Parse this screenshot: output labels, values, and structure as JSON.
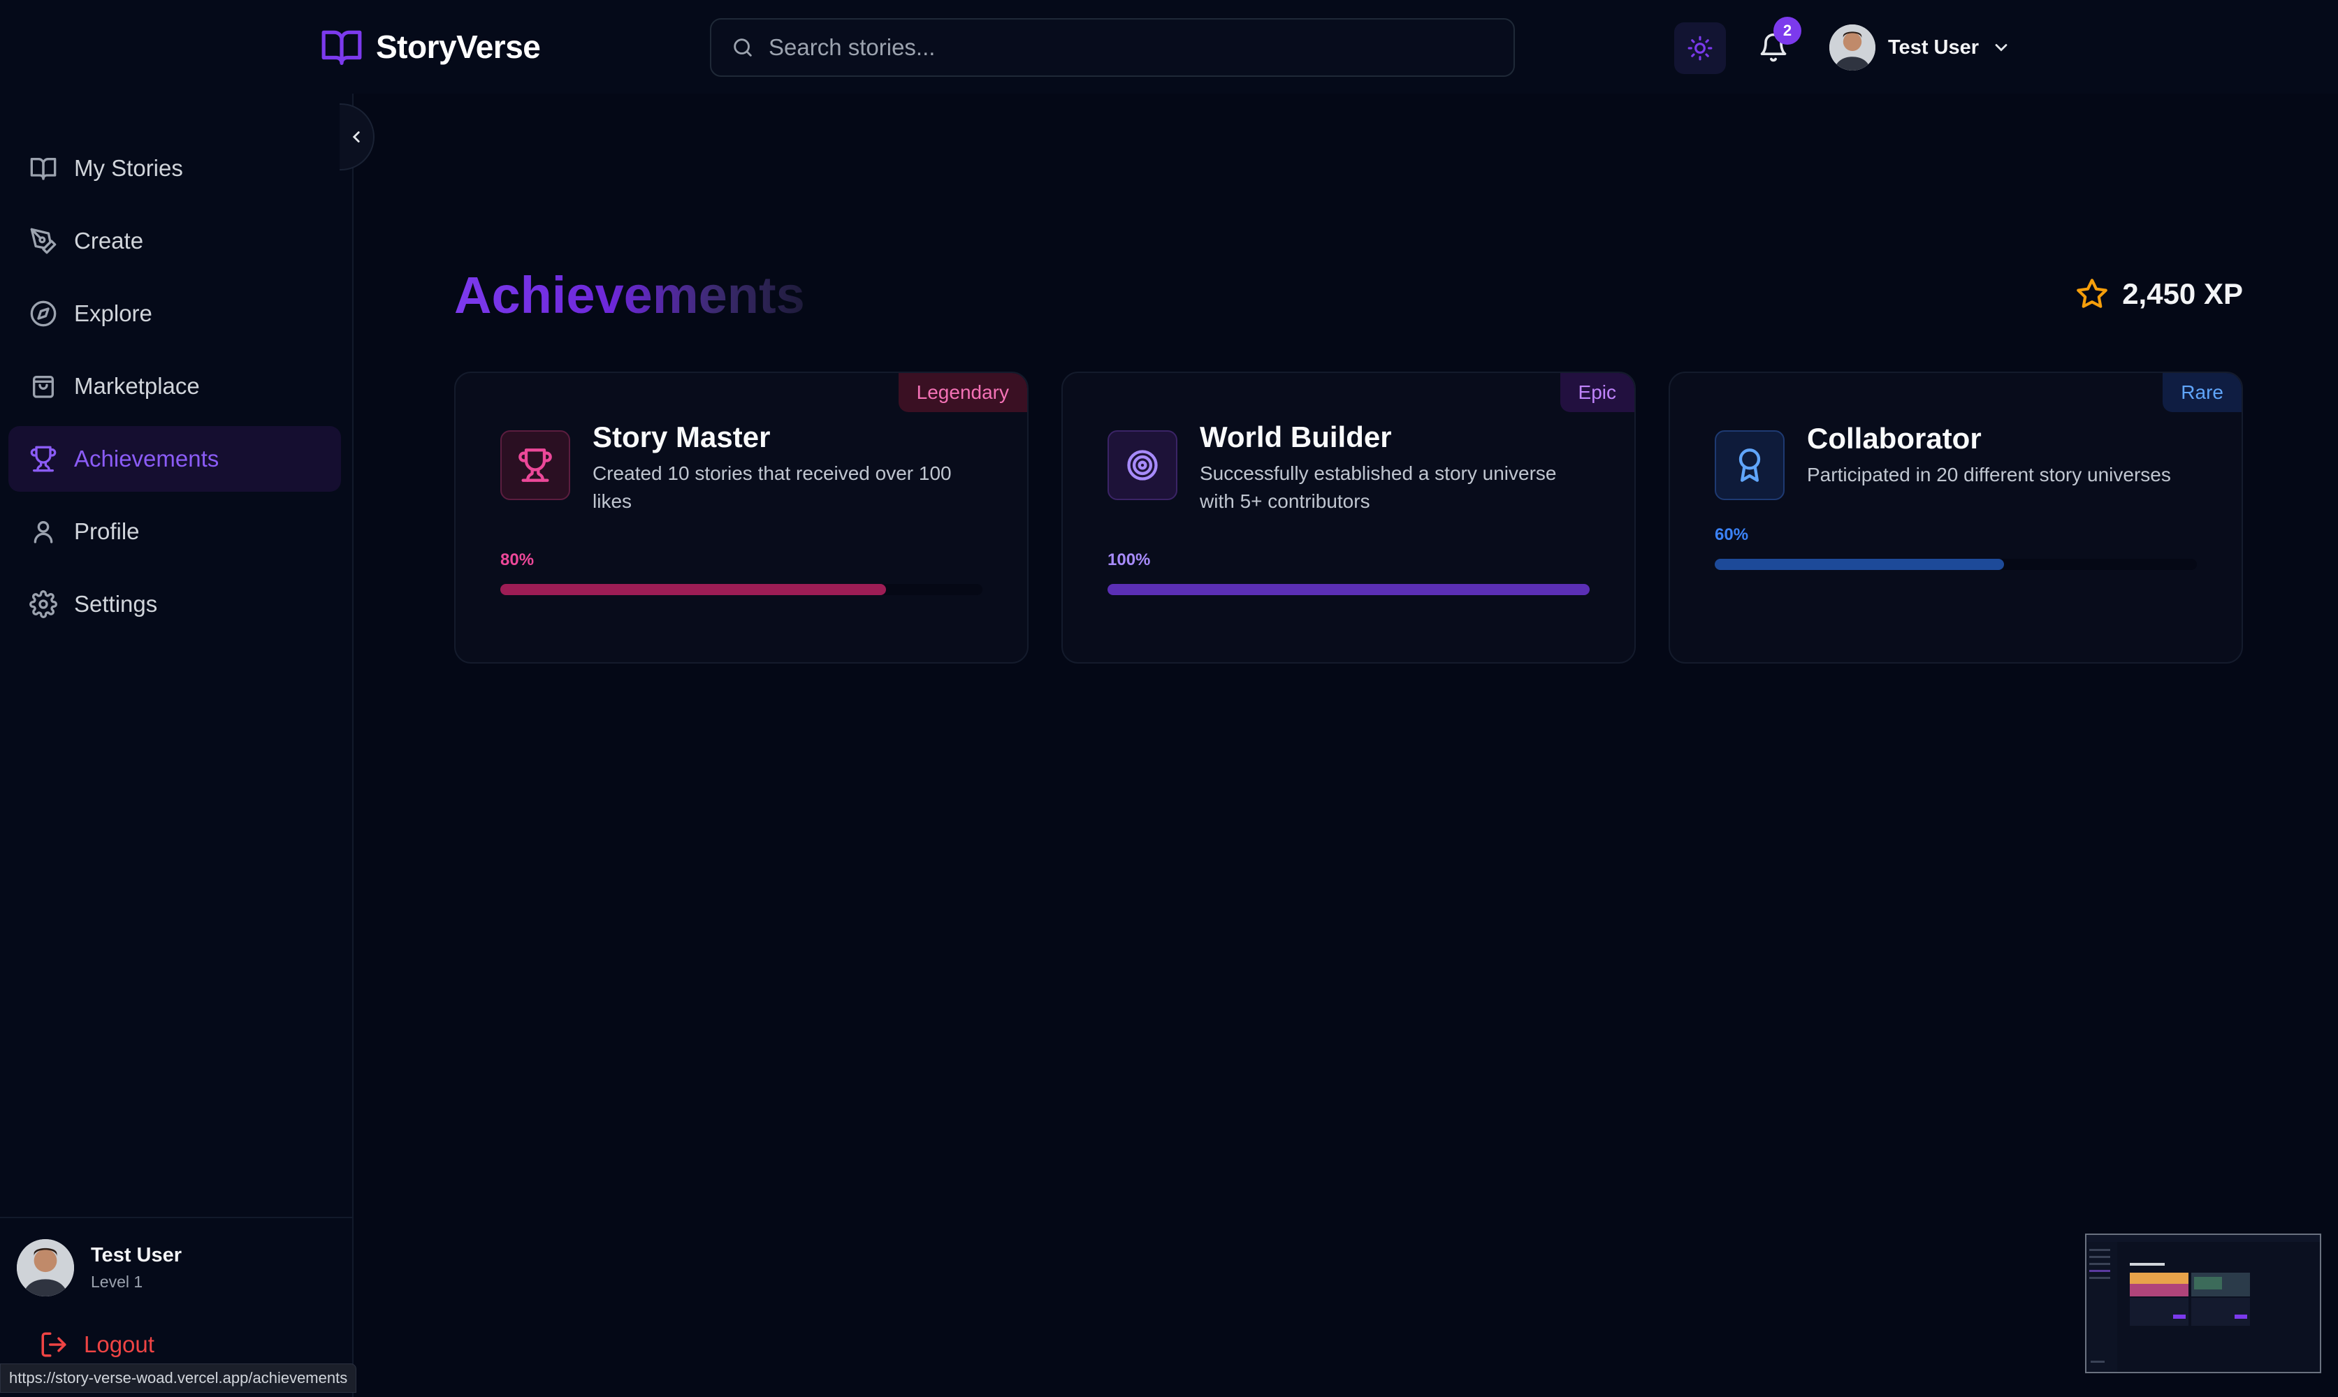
{
  "app": {
    "name": "StoryVerse"
  },
  "search": {
    "placeholder": "Search stories..."
  },
  "notifications": {
    "count": "2"
  },
  "user": {
    "name": "Test User",
    "level": "Level 1"
  },
  "sidebar": {
    "items": [
      {
        "label": "My Stories",
        "icon": "book-open-icon"
      },
      {
        "label": "Create",
        "icon": "pen-tool-icon"
      },
      {
        "label": "Explore",
        "icon": "compass-icon"
      },
      {
        "label": "Marketplace",
        "icon": "shopping-bag-icon"
      },
      {
        "label": "Achievements",
        "icon": "trophy-icon",
        "active": true
      },
      {
        "label": "Profile",
        "icon": "user-icon"
      },
      {
        "label": "Settings",
        "icon": "gear-icon"
      }
    ],
    "logout_label": "Logout"
  },
  "main": {
    "title": "Achievements",
    "xp": "2,450 XP",
    "achievements": [
      {
        "rarity": "Legendary",
        "title": "Story Master",
        "description": "Created 10 stories that received over 100 likes",
        "progress_label": "80%",
        "progress": 0.8,
        "icon": "trophy-icon",
        "accent": "#ec4899"
      },
      {
        "rarity": "Epic",
        "title": "World Builder",
        "description": "Successfully established a story universe with 5+ contributors",
        "progress_label": "100%",
        "progress": 1.0,
        "icon": "target-icon",
        "accent": "#a78bfa"
      },
      {
        "rarity": "Rare",
        "title": "Collaborator",
        "description": "Participated in 20 different story universes",
        "progress_label": "60%",
        "progress": 0.6,
        "icon": "award-icon",
        "accent": "#3b82f6"
      }
    ]
  },
  "status_bar": {
    "url": "https://story-verse-woad.vercel.app/achievements"
  },
  "colors": {
    "background": "#040816",
    "brand": "#7c3aed",
    "legendary": "#ec4899",
    "epic": "#a78bfa",
    "rare": "#3b82f6",
    "logout": "#ef4444"
  }
}
